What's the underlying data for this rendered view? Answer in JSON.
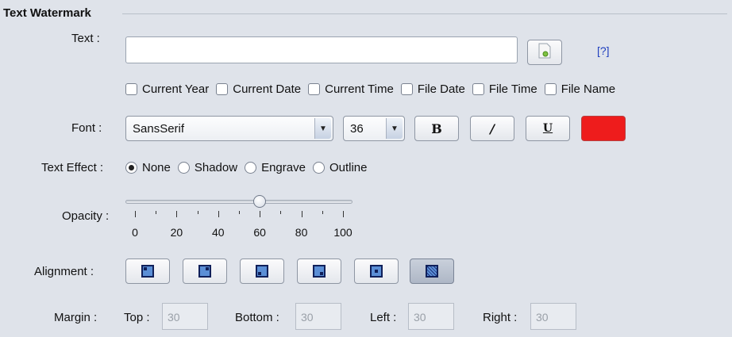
{
  "group_title": "Text Watermark",
  "labels": {
    "text": "Text :",
    "font": "Font :",
    "text_effect": "Text Effect :",
    "opacity": "Opacity :",
    "alignment": "Alignment :",
    "margin": "Margin :"
  },
  "text_input": {
    "value": "",
    "placeholder": ""
  },
  "insert_button": {
    "icon": "picture-icon"
  },
  "help_link": "[?]",
  "checkboxes": [
    {
      "label": "Current Year",
      "checked": false
    },
    {
      "label": "Current Date",
      "checked": false
    },
    {
      "label": "Current Time",
      "checked": false
    },
    {
      "label": "File Date",
      "checked": false
    },
    {
      "label": "File Time",
      "checked": false
    },
    {
      "label": "File Name",
      "checked": false
    }
  ],
  "font": {
    "family": "SansSerif",
    "size": "36",
    "bold_label": "B",
    "italic_label": "/",
    "underline_label": "U",
    "color": "#ee1c1c"
  },
  "text_effect": {
    "options": [
      "None",
      "Shadow",
      "Engrave",
      "Outline"
    ],
    "selected": "None"
  },
  "opacity": {
    "value": 60,
    "ticks": [
      "0",
      "20",
      "40",
      "60",
      "80",
      "100"
    ]
  },
  "alignment": {
    "options": [
      "top-left",
      "top-right",
      "bottom-left",
      "bottom-right",
      "center",
      "tile"
    ],
    "selected": "tile"
  },
  "margin": {
    "top_label": "Top :",
    "top_value": "30",
    "bottom_label": "Bottom :",
    "bottom_value": "30",
    "left_label": "Left :",
    "left_value": "30",
    "right_label": "Right :",
    "right_value": "30"
  }
}
